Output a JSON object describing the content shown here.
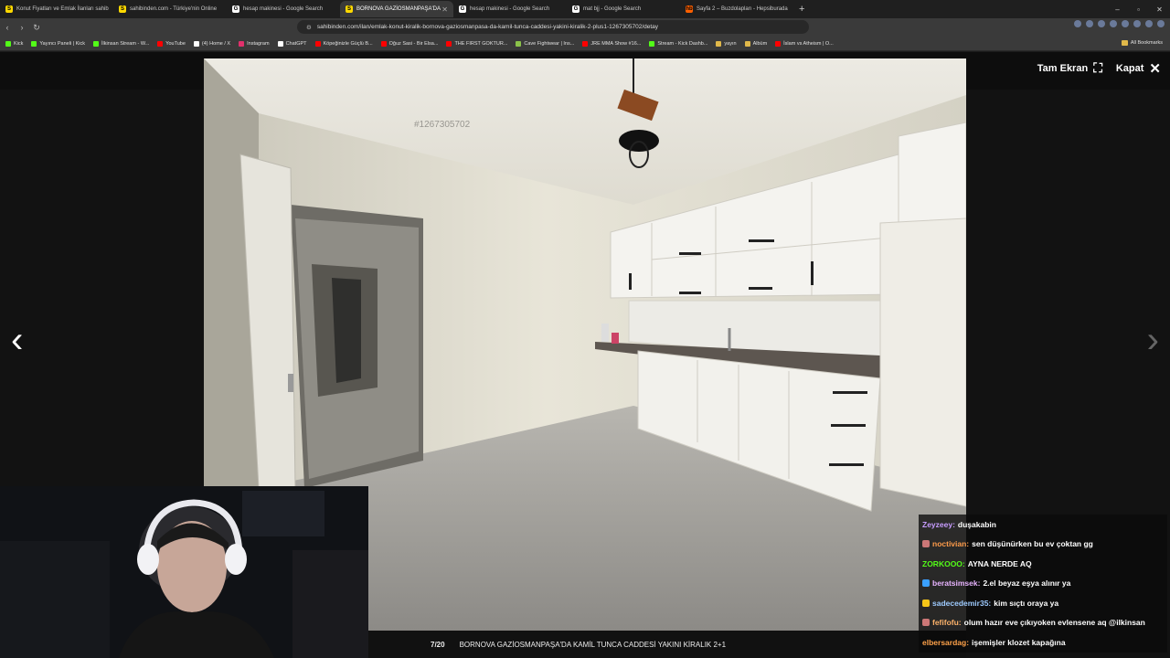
{
  "browser": {
    "tabs": [
      {
        "title": "Konut Fiyatları ve Emlak İlanları sahib",
        "fav_color": "#ffd900",
        "fav_glyph": "S",
        "active": false
      },
      {
        "title": "sahibinden.com - Türkiye'nin Online",
        "fav_color": "#ffd900",
        "fav_glyph": "S",
        "active": false
      },
      {
        "title": "hesap makinesi - Google Search",
        "fav_color": "#ffffff",
        "fav_glyph": "G",
        "active": false
      },
      {
        "title": "BORNOVA GAZİOSMANPAŞA'DA",
        "fav_color": "#ffd900",
        "fav_glyph": "S",
        "active": true
      },
      {
        "title": "hesap makinesi - Google Search",
        "fav_color": "#ffffff",
        "fav_glyph": "G",
        "active": false
      },
      {
        "title": "mat bjj - Google Search",
        "fav_color": "#ffffff",
        "fav_glyph": "G",
        "active": false
      },
      {
        "title": "Sayfa 2 – Buzdolapları - Hepsiburada",
        "fav_color": "#ff6000",
        "fav_glyph": "hb",
        "active": false
      }
    ],
    "new_tab": "+",
    "window_controls": [
      "–",
      "▫",
      "✕"
    ],
    "url": "sahibinden.com/ilan/emlak-konut-kiralik-bornova-gaziosmanpasa-da-kamil-tunca-caddesi-yakini-kiralik-2-plus1-1267305702/detay",
    "bookmarks": [
      {
        "label": "Kick",
        "color": "#53fc18"
      },
      {
        "label": "Yayıncı Paneli | Kick",
        "color": "#53fc18"
      },
      {
        "label": "İlkinsan Stream - W...",
        "color": "#53fc18"
      },
      {
        "label": "YouTube",
        "color": "#ff0000"
      },
      {
        "label": "(4) Home / X",
        "color": "#ffffff"
      },
      {
        "label": "Instagram",
        "color": "#e1306c"
      },
      {
        "label": "ChatGPT",
        "color": "#ffffff"
      },
      {
        "label": "Köpeğinizle Güçlü B...",
        "color": "#ff0000"
      },
      {
        "label": "Oğuz Sasi - Bir Elsa...",
        "color": "#ff0000"
      },
      {
        "label": "THE FIRST GOKTUR...",
        "color": "#ff0000"
      },
      {
        "label": "Cave Fightwear | Ins...",
        "color": "#8bc34a"
      },
      {
        "label": "JRE MMA Show #16...",
        "color": "#ff0000"
      },
      {
        "label": "Stream - Kick Dashb...",
        "color": "#53fc18"
      },
      {
        "label": "yayın",
        "color": "#e0b84a"
      },
      {
        "label": "Albüm",
        "color": "#e0b84a"
      },
      {
        "label": "İslam vs Atheism | O...",
        "color": "#ff0000"
      }
    ],
    "all_bookmarks": "All Bookmarks"
  },
  "viewer": {
    "fullscreen_label": "Tam Ekran",
    "fullscreen_icon": "⛶",
    "close_label": "Kapat",
    "close_icon": "✕",
    "prev_icon": "‹",
    "next_icon": "›",
    "photo_id_watermark": "#1267305702",
    "counter": "7/20",
    "caption": "BORNOVA GAZİOSMANPAŞA'DA KAMİL TUNCA CADDESİ YAKINI KİRALIK 2+1"
  },
  "chat": [
    {
      "user": "Zeyzeey:",
      "text": "duşakabin",
      "color": "#c79cff",
      "badge": ""
    },
    {
      "user": "noctivian:",
      "text": "sen düşünürken bu ev çoktan gg",
      "color": "#ff9c4a",
      "badge": "#c77"
    },
    {
      "user": "ZORKOOO:",
      "text": "AYNA NERDE AQ",
      "color": "#53fc18",
      "badge": ""
    },
    {
      "user": "beratsimsek:",
      "text": "2.el beyaz eşya alınır ya",
      "color": "#e8b4ff",
      "badge": "#3aa0ff"
    },
    {
      "user": "sadecedemir35:",
      "text": "kim sıçtı oraya ya",
      "color": "#9ecbff",
      "badge": "#f5c518"
    },
    {
      "user": "fefifofu:",
      "text": "olum hazır eve çıkıyoken evlensene aq @ilkinsan",
      "color": "#ffb36b",
      "badge": "#c77"
    },
    {
      "user": "elbersardag:",
      "text": "işemişler klozet kapağına",
      "color": "#ffa24a",
      "badge": ""
    }
  ]
}
